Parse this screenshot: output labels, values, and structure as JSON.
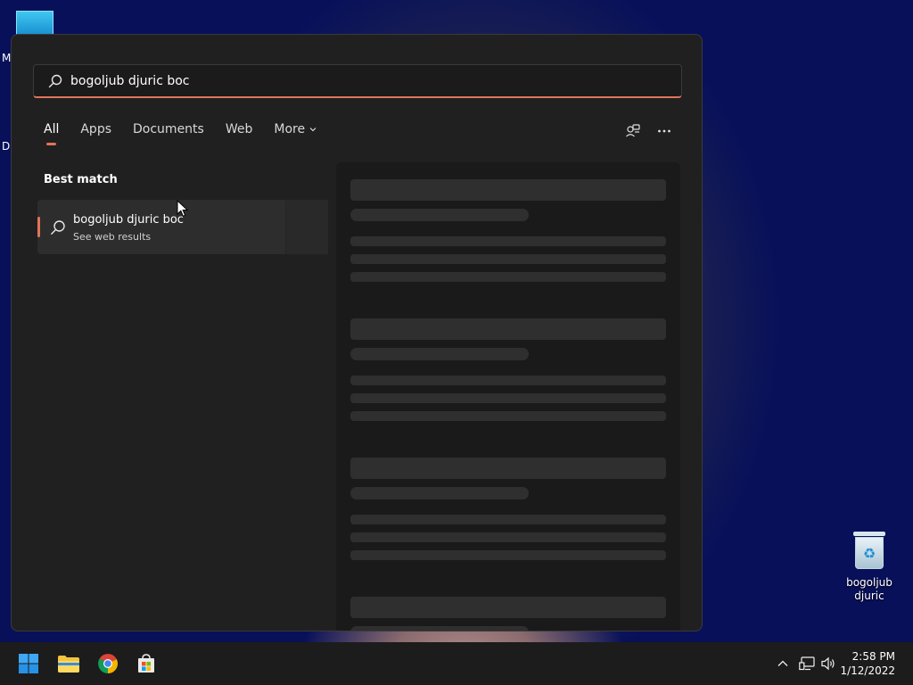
{
  "desktop": {
    "left_text_1": "M",
    "left_text_2": "D",
    "recycle_bin_label": "bogoljub djuric"
  },
  "search": {
    "query": "bogoljub djuric boc",
    "accent_color": "#e0735a"
  },
  "tabs": [
    {
      "label": "All",
      "active": true
    },
    {
      "label": "Apps"
    },
    {
      "label": "Documents"
    },
    {
      "label": "Web"
    },
    {
      "label": "More"
    }
  ],
  "results": {
    "section_title": "Best match",
    "best_match": {
      "title": "bogoljub djuric boc",
      "subtitle": "See web results"
    }
  },
  "taskbar": {
    "apps": [
      "windows-start-icon",
      "file-explorer-icon",
      "chrome-icon",
      "microsoft-store-icon"
    ],
    "time": "2:58 PM",
    "date": "1/12/2022"
  }
}
